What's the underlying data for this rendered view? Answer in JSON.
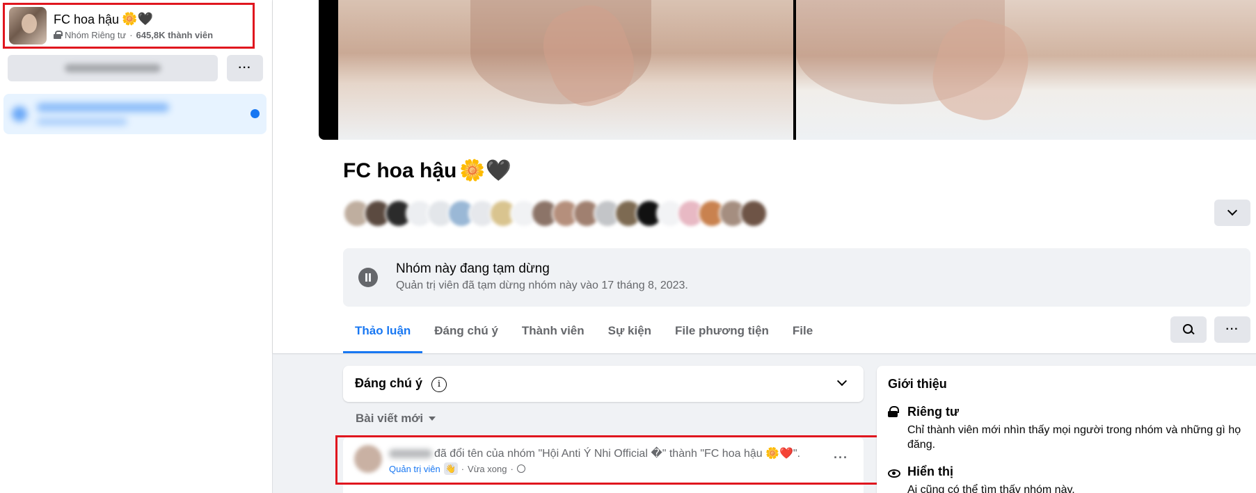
{
  "sidebar": {
    "group_name": "FC hoa hậu",
    "group_name_emoji": "🌼🖤",
    "privacy": "Nhóm Riêng tư",
    "separator": "·",
    "members": "645,8K thành viên",
    "more_label": "···"
  },
  "header": {
    "title": "FC hoa hậu",
    "title_emoji": "🌼🖤",
    "pause_title": "Nhóm này đang tạm dừng",
    "pause_subtitle": "Quản trị viên đã tạm dừng nhóm này vào 17 tháng 8, 2023.",
    "tabs": [
      {
        "label": "Thảo luận",
        "active": true
      },
      {
        "label": "Đáng chú ý",
        "active": false
      },
      {
        "label": "Thành viên",
        "active": false
      },
      {
        "label": "Sự kiện",
        "active": false
      },
      {
        "label": "File phương tiện",
        "active": false
      },
      {
        "label": "File",
        "active": false
      }
    ],
    "more_label": "···"
  },
  "feed": {
    "noteworthy_title": "Đáng chú ý",
    "info_glyph": "i",
    "sort_label": "Bài viết mới",
    "post": {
      "text": "đã đổi tên của nhóm \"Hội Anti Ý Nhi Official �\" thành \"FC hoa hậu 🌼❤️\".",
      "role": "Quản trị viên",
      "badge": "👋",
      "separator": "·",
      "time": "Vừa xong",
      "more_label": "···"
    }
  },
  "about": {
    "title": "Giới thiệu",
    "privacy_heading": "Riêng tư",
    "privacy_text": "Chỉ thành viên mới nhìn thấy mọi người trong nhóm và những gì họ đăng.",
    "visibility_heading": "Hiển thị",
    "visibility_text": "Ai cũng có thể tìm thấy nhóm này."
  },
  "colors": {
    "accent": "#1877f2",
    "highlight_border": "#e0161e",
    "secondary_text": "#65676b",
    "button_bg": "#e4e6eb",
    "page_bg": "#f0f2f5"
  },
  "icons": [
    "lock-icon",
    "pause-icon",
    "search-icon",
    "more-icon",
    "chevron-down-icon",
    "info-icon",
    "globe-icon",
    "eye-icon",
    "notification-dot"
  ]
}
